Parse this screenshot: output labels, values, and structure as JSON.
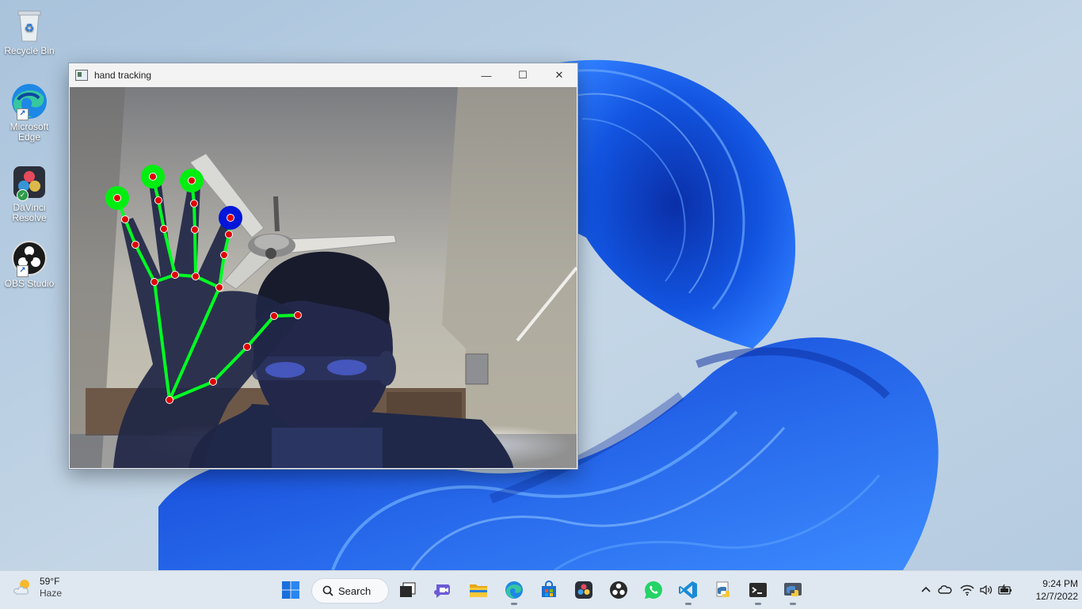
{
  "desktop": {
    "icons": [
      {
        "label": "Recycle Bin"
      },
      {
        "label": "Microsoft Edge"
      },
      {
        "label": "DaVinci Resolve"
      },
      {
        "label": "OBS Studio"
      }
    ]
  },
  "window": {
    "title": "hand tracking",
    "minimize_glyph": "—",
    "maximize_glyph": "☐",
    "close_glyph": "✕",
    "landmark_colors": {
      "connection": "#00ff22",
      "joint": "#e00000",
      "fingertip_marker": "#00ee11",
      "active_marker": "#0016d8"
    }
  },
  "taskbar": {
    "weather": {
      "temp": "59°F",
      "condition": "Haze"
    },
    "search": {
      "label": "Search"
    },
    "apps": [
      "start-icon",
      "task-view-icon",
      "teams-chat-icon",
      "file-explorer-icon",
      "edge-icon",
      "store-icon",
      "davinci-resolve-icon",
      "obs-icon",
      "whatsapp-icon",
      "vscode-icon",
      "python-idle-icon",
      "terminal-icon",
      "python-app-icon"
    ],
    "clock": {
      "time": "9:24 PM",
      "date": "12/7/2022"
    }
  },
  "colors": {
    "accent": "#1a5fd8",
    "taskbar_bg": "#dfe8f1"
  }
}
